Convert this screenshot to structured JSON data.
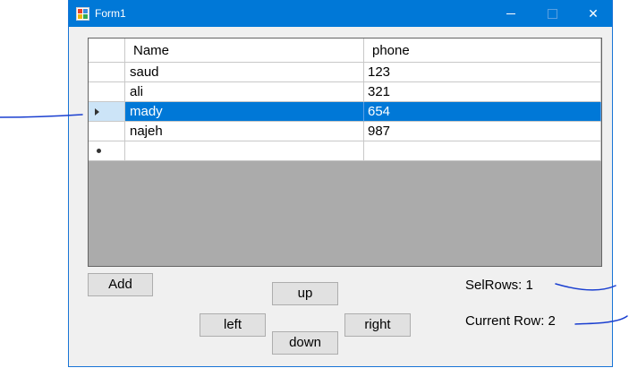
{
  "window": {
    "title": "Form1",
    "accent": "#0078d7"
  },
  "grid": {
    "columns": [
      "Name",
      "phone"
    ],
    "rows": [
      {
        "name": "saud",
        "phone": "123",
        "selected": false
      },
      {
        "name": "ali",
        "phone": "321",
        "selected": false
      },
      {
        "name": "mady",
        "phone": "654",
        "selected": true
      },
      {
        "name": "najeh",
        "phone": "987",
        "selected": false
      }
    ],
    "new_row": {
      "name": "",
      "phone": ""
    },
    "selection_color": "#0078d7"
  },
  "buttons": {
    "add": "Add",
    "up": "up",
    "left": "left",
    "right": "right",
    "down": "down"
  },
  "status": {
    "sel_rows": "SelRows: 1",
    "current_row": "Current Row: 2"
  },
  "annotation_color": "#1a3fd0"
}
